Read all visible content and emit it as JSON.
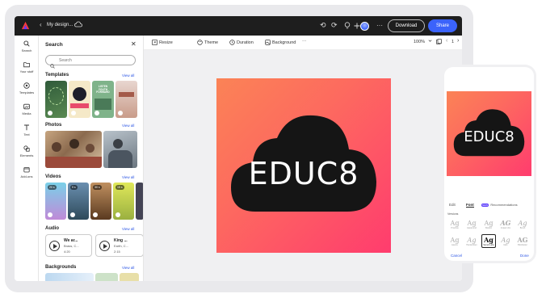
{
  "app": {
    "brand_color": "#3b63fb",
    "doc_title": "My design...",
    "download_label": "Download",
    "share_label": "Share"
  },
  "rail": [
    {
      "label": "Search",
      "icon": "search-icon"
    },
    {
      "label": "Your stuff",
      "icon": "folder-icon"
    },
    {
      "label": "Templates",
      "icon": "templates-icon"
    },
    {
      "label": "Media",
      "icon": "media-icon"
    },
    {
      "label": "Text",
      "icon": "text-icon"
    },
    {
      "label": "Elements",
      "icon": "elements-icon"
    },
    {
      "label": "Add-ons",
      "icon": "add-ons-icon"
    }
  ],
  "panel": {
    "title": "Search",
    "search_placeholder": "Search",
    "view_all": "View all",
    "sections": {
      "templates": "Templates",
      "photos": "Photos",
      "videos": "Videos",
      "audio": "Audio",
      "backgrounds": "Backgrounds"
    },
    "template_texts": [
      "LISTEN YOUTH FORWARD"
    ],
    "video_badges": [
      "20 s",
      "9 s",
      "30 s",
      "15 s"
    ],
    "audio": [
      {
        "title": "We ar...",
        "artist": "Brass, C...",
        "duration": "4:20"
      },
      {
        "title": "King ...",
        "artist": "Earth, C...",
        "duration": "2:15"
      }
    ]
  },
  "toolbar": {
    "resize": "Resize",
    "theme": "Theme",
    "duration": "Duration",
    "background": "Background",
    "more": "···",
    "zoom": "100%",
    "page_prev": "‹",
    "page_num": "1",
    "page_next": "›"
  },
  "canvas": {
    "logo_text": "EDUC8",
    "gradient": [
      "#fb8356",
      "#ff3c6e"
    ]
  },
  "phone": {
    "tabs": [
      "Edit",
      "Font",
      "Recommendations"
    ],
    "new_badge": "NEW",
    "versions_label": "Versions",
    "fonts": [
      {
        "glyph": "Ag",
        "name": "Proxima"
      },
      {
        "glyph": "Ag",
        "name": "Garamond"
      },
      {
        "glyph": "Ag",
        "name": "Bodoni"
      },
      {
        "glyph": "AG",
        "name": "Impact Jim"
      },
      {
        "glyph": "Ag",
        "name": "Brush"
      },
      {
        "glyph": "Ag",
        "name": "Apercu"
      },
      {
        "glyph": "Ag",
        "name": "Handwritten"
      },
      {
        "glyph": "Ag",
        "name": "Stencil Labs"
      },
      {
        "glyph": "Ag",
        "name": "Italic"
      },
      {
        "glyph": "AG",
        "name": "Blockletter"
      }
    ],
    "cancel": "Cancel",
    "done": "Done"
  }
}
